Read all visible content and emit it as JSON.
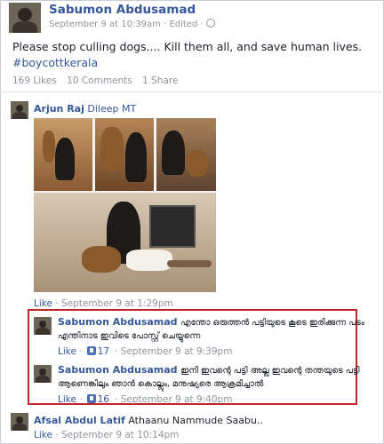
{
  "post": {
    "author": "Sabumon Abdusamad",
    "meta": "September 9 at 10:39am · Edited ·",
    "text": "Please stop culling dogs.... Kill them all, and save human lives.",
    "hashtag": "#boycottkerala",
    "likes": "169 Likes",
    "comments": "10 Comments",
    "shares": "1 Share"
  },
  "comments": [
    {
      "author": "Arjun Raj",
      "text": "Dileep MT",
      "like_label": "Like",
      "time": "September 9 at 1:29pm"
    },
    {
      "author": "Sabumon Abdusamad",
      "text_line1": "എന്തോ ഒരുത്തൻ പട്ടിയുടെ കൂടെ ഇരിക്കുന്ന പടം",
      "text_line2": "എന്തിനാട ഇവിടെ പോസ്റ്റ് ചെയ്യുന്നെ",
      "like_label": "Like",
      "like_count": "17",
      "time": "September 9 at 9:39pm"
    },
    {
      "author": "Sabumon Abdusamad",
      "text_line1": "ഇനി ഇവന്റെ പട്ടി അല്ല ഇവന്റെ തന്തയുടെ പട്ടി",
      "text_line2": "ആണെങ്കിലും ഞാൻ കൊല്ലും, മനുഷ്യരെ ആക്രമിച്ചാൽ",
      "like_label": "Like",
      "like_count": "16",
      "time": "September 9 at 9:40pm"
    },
    {
      "author": "Afsal Abdul Latif",
      "text": "Athaanu Nammude Saabu..",
      "like_label": "Like",
      "time": "September 9 at 10:14pm"
    }
  ],
  "icons": {
    "thumb": "thumbs-up-icon",
    "globe": "globe-icon"
  },
  "colors": {
    "link": "#365899",
    "highlight": "#c0252a",
    "meta": "#90949c"
  }
}
